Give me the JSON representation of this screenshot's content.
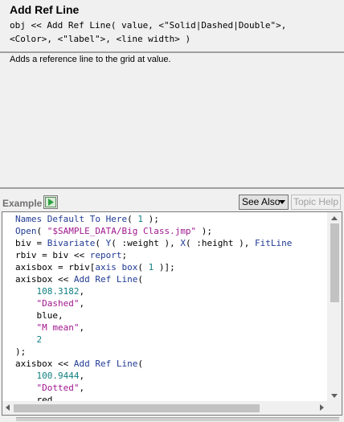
{
  "header": {
    "title": "Add Ref Line",
    "syntax_line1": "obj << Add Ref Line( value, <\"Solid|Dashed|Double\">,",
    "syntax_line2": "<Color>, <\"label\">, <line width> )"
  },
  "description": "Adds a reference line to the grid at value.",
  "toolbar": {
    "example_label": "Example",
    "run_icon": "play-icon",
    "see_also_label": "See Also",
    "topic_help_label": "Topic Help"
  },
  "code_lines": [
    [
      {
        "t": "kw",
        "v": "Names Default To Here"
      },
      {
        "t": "plain",
        "v": "( "
      },
      {
        "t": "num",
        "v": "1"
      },
      {
        "t": "plain",
        "v": " );"
      }
    ],
    [
      {
        "t": "kw",
        "v": "Open"
      },
      {
        "t": "plain",
        "v": "( "
      },
      {
        "t": "str",
        "v": "\"$SAMPLE_DATA/Big Class.jmp\""
      },
      {
        "t": "plain",
        "v": " );"
      }
    ],
    [
      {
        "t": "plain",
        "v": "biv = "
      },
      {
        "t": "kw",
        "v": "Bivariate"
      },
      {
        "t": "plain",
        "v": "( "
      },
      {
        "t": "kw",
        "v": "Y"
      },
      {
        "t": "plain",
        "v": "( :weight ), "
      },
      {
        "t": "kw",
        "v": "X"
      },
      {
        "t": "plain",
        "v": "( :height ), "
      },
      {
        "t": "kw",
        "v": "FitLine"
      }
    ],
    [
      {
        "t": "plain",
        "v": "rbiv = biv << "
      },
      {
        "t": "kw",
        "v": "report"
      },
      {
        "t": "plain",
        "v": ";"
      }
    ],
    [
      {
        "t": "plain",
        "v": "axisbox = rbiv["
      },
      {
        "t": "kw",
        "v": "axis box"
      },
      {
        "t": "plain",
        "v": "( "
      },
      {
        "t": "num",
        "v": "1"
      },
      {
        "t": "plain",
        "v": " )];"
      }
    ],
    [
      {
        "t": "plain",
        "v": "axisbox << "
      },
      {
        "t": "kw",
        "v": "Add Ref Line"
      },
      {
        "t": "plain",
        "v": "("
      }
    ],
    [
      {
        "t": "plain",
        "v": "    "
      },
      {
        "t": "num",
        "v": "108.3182"
      },
      {
        "t": "plain",
        "v": ","
      }
    ],
    [
      {
        "t": "plain",
        "v": "    "
      },
      {
        "t": "str",
        "v": "\"Dashed\""
      },
      {
        "t": "plain",
        "v": ","
      }
    ],
    [
      {
        "t": "plain",
        "v": "    blue,"
      }
    ],
    [
      {
        "t": "plain",
        "v": "    "
      },
      {
        "t": "str",
        "v": "\"M mean\""
      },
      {
        "t": "plain",
        "v": ","
      }
    ],
    [
      {
        "t": "plain",
        "v": "    "
      },
      {
        "t": "num",
        "v": "2"
      }
    ],
    [
      {
        "t": "plain",
        "v": ");"
      }
    ],
    [
      {
        "t": "plain",
        "v": "axisbox << "
      },
      {
        "t": "kw",
        "v": "Add Ref Line"
      },
      {
        "t": "plain",
        "v": "("
      }
    ],
    [
      {
        "t": "plain",
        "v": "    "
      },
      {
        "t": "num",
        "v": "100.9444"
      },
      {
        "t": "plain",
        "v": ","
      }
    ],
    [
      {
        "t": "plain",
        "v": "    "
      },
      {
        "t": "str",
        "v": "\"Dotted\""
      },
      {
        "t": "plain",
        "v": ","
      }
    ],
    [
      {
        "t": "plain",
        "v": "    red,"
      }
    ]
  ],
  "colors": {
    "keyword": "#1f3a93",
    "number": "#0f7f7f",
    "string": "#a0168f",
    "run_icon_green": "#2ea043"
  }
}
